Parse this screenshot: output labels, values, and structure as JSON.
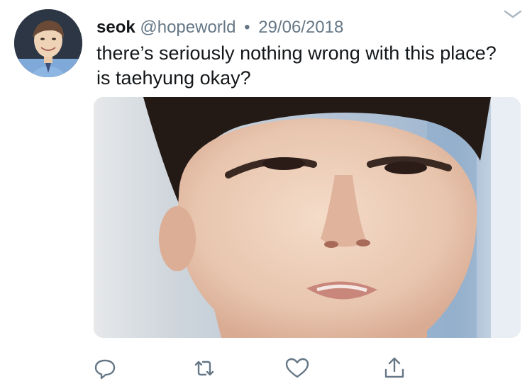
{
  "tweet": {
    "author_name": "seok",
    "handle": "@hopeworld",
    "separator": "•",
    "date": "29/06/2018",
    "text": "there’s seriously nothing wrong with this place? is taehyung okay?"
  },
  "icons": {
    "menu": "chevron-down-icon",
    "reply": "reply-icon",
    "retweet": "retweet-icon",
    "like": "heart-icon",
    "share": "share-icon"
  },
  "colors": {
    "text": "#14171a",
    "secondary": "#657786",
    "icon": "#657786"
  }
}
